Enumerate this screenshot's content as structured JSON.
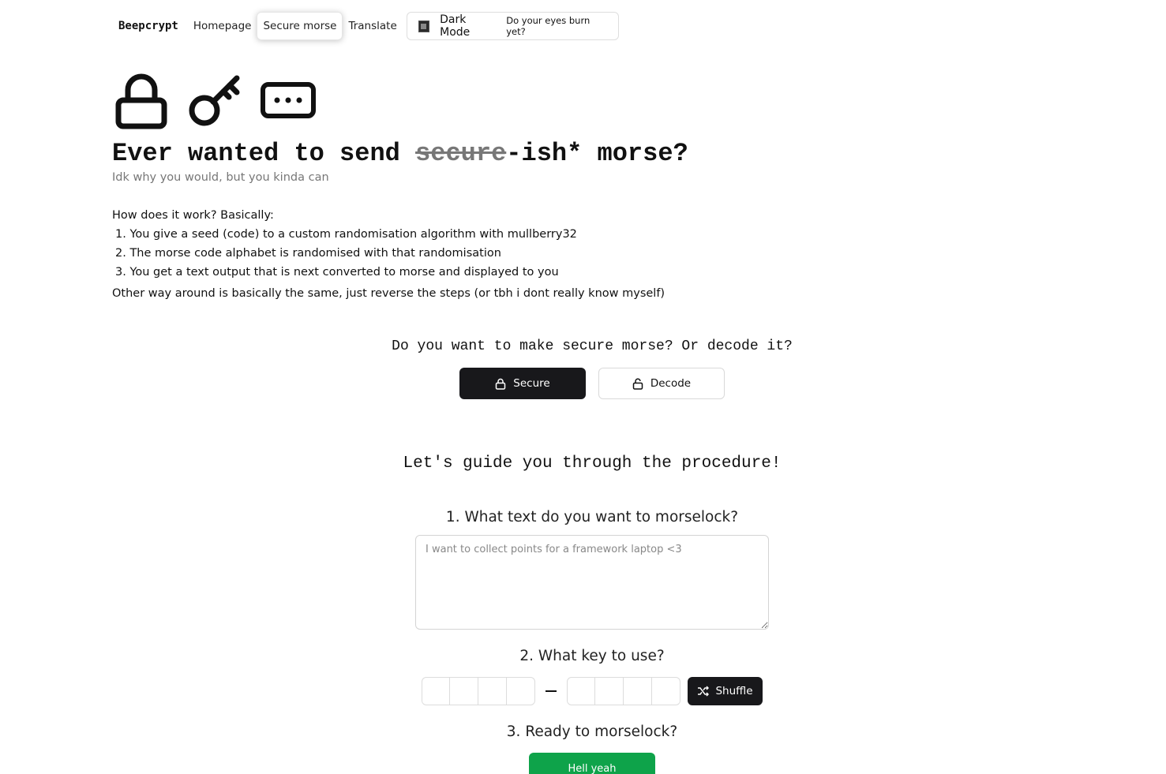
{
  "nav": {
    "brand": "Beepcrypt",
    "links": [
      "Homepage",
      "Secure morse",
      "Translate"
    ],
    "active": "Secure morse",
    "dark_mode": {
      "title": "Dark Mode",
      "subtitle": "Do your eyes burn yet?"
    }
  },
  "hero": {
    "icons": [
      "lock-icon",
      "key-icon",
      "ellipsis-box-icon"
    ],
    "title_before": "Ever wanted to send ",
    "title_strike": "secure",
    "title_after": "-ish* morse?",
    "subtitle": "Idk why you would, but you kinda can"
  },
  "how": {
    "intro": "How does it work? Basically:",
    "steps": [
      "1. You give a seed (code) to a custom randomisation algorithm with mullberry32",
      "2. The morse code alphabet is randomised with that randomisation",
      "3. You get a text output that is next converted to morse and displayed to you"
    ],
    "other": "Other way around is basically the same, just reverse the steps (or tbh i dont really know myself)"
  },
  "choice": {
    "question": "Do you want to make secure morse? Or decode it?",
    "secure_label": "Secure",
    "decode_label": "Decode",
    "selected": "Secure"
  },
  "guide": {
    "title": "Let's guide you through the procedure!",
    "step1": "1. What text do you want to morselock?",
    "text_placeholder": "I want to collect points for a framework laptop <3",
    "text_value": "",
    "step2": "2. What key to use?",
    "key_left": [
      "",
      "",
      "",
      ""
    ],
    "key_right": [
      "",
      "",
      "",
      ""
    ],
    "shuffle_label": "Shuffle",
    "step3": "3. Ready to morselock?",
    "go_label": "Hell yeah"
  },
  "colors": {
    "primary": "#18181b",
    "success": "#0ea34a",
    "muted": "#777777"
  }
}
